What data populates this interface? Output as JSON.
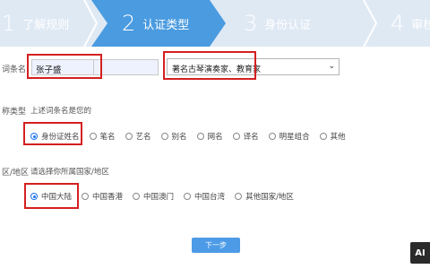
{
  "steps": [
    {
      "num": "1",
      "label": "了解规则"
    },
    {
      "num": "2",
      "label": "认证类型"
    },
    {
      "num": "3",
      "label": "身份认证"
    },
    {
      "num": "4",
      "label": "审核"
    }
  ],
  "colors": {
    "active_step": "#4a9be0",
    "step_bar": "#dfe9f4",
    "highlight": "#d42020",
    "primary_button": "#4d9be6"
  },
  "entry": {
    "label": "词条名",
    "name_value": "张子盛",
    "select_value": "著名古琴演奏家、教育家"
  },
  "name_type": {
    "label": "称类型",
    "hint": "上述词条名是您的",
    "options": [
      "身份证姓名",
      "笔名",
      "艺名",
      "别名",
      "网名",
      "译名",
      "明星组合",
      "其他"
    ],
    "selected": "身份证姓名"
  },
  "region": {
    "label": "区/地区",
    "hint": "请选择你所属国家/地区",
    "options": [
      "中国大陆",
      "中国香港",
      "中国澳门",
      "中国台湾",
      "其他国家/地区"
    ],
    "selected": "中国大陆"
  },
  "next_button": "下一步",
  "badge": "AI"
}
